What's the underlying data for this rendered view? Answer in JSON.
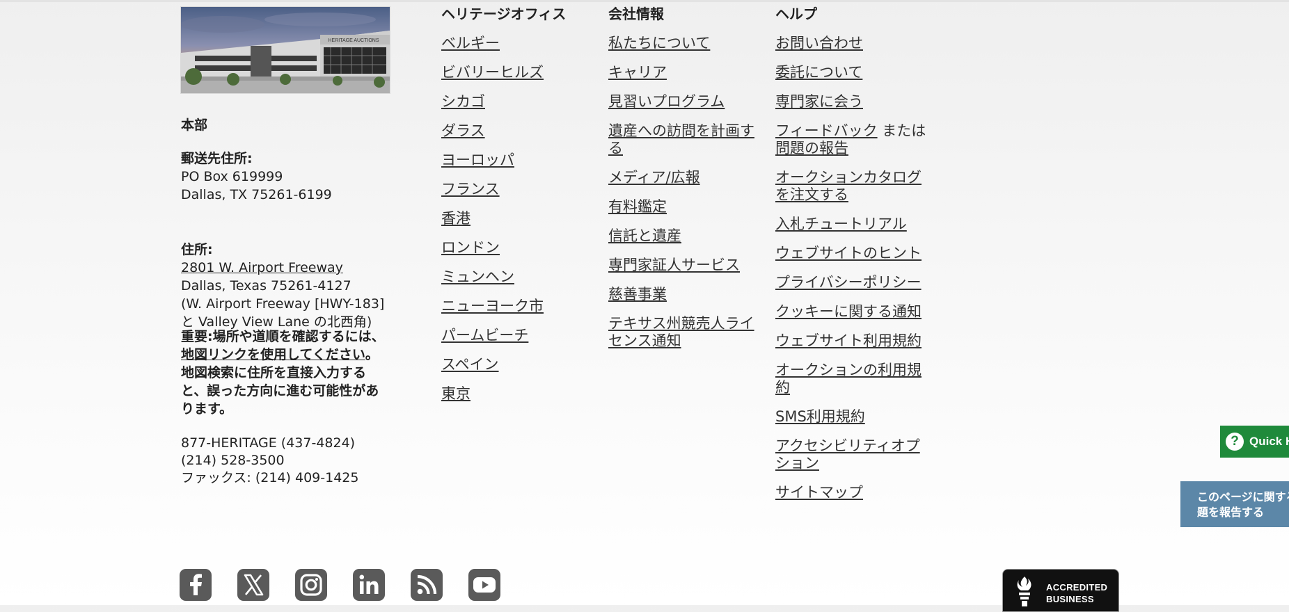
{
  "headquarters": {
    "title": "本部",
    "mailing_label": "郵送先住所:",
    "mailing_line1": "PO Box 619999",
    "mailing_line2": "Dallas, TX 75261-6199",
    "address_label": "住所:",
    "address_link": "2801 W. Airport Freeway",
    "address_line2": "Dallas, Texas 75261-4127",
    "address_line3": "(W. Airport Freeway [HWY-183]",
    "address_line4": "と Valley View Lane の北西角)",
    "warning_prefix": "重要:場所や道順を確認するには、",
    "warning_link": "地図リンクを使用してください",
    "warning_suffix": "。地図検索に住所を直接入力すると、誤った方向に進む可能性があります。",
    "phone1": "877-HERITAGE (437-4824)",
    "phone2": "(214) 528-3500",
    "fax": "ファックス: (214) 409-1425",
    "photo_sign": "HERITAGE AUCTIONS"
  },
  "offices": {
    "heading": "ヘリテージオフィス",
    "items": [
      "ベルギー",
      "ビバリーヒルズ",
      "シカゴ",
      "ダラス",
      "ヨーロッパ",
      "フランス",
      "香港",
      "ロンドン",
      "ミュンヘン",
      "ニューヨーク市",
      "パームビーチ",
      "スペイン",
      "東京"
    ]
  },
  "company": {
    "heading": "会社情報",
    "items": [
      "私たちについて",
      "キャリア",
      "見習いプログラム",
      "遺産への訪問を計画する",
      "メディア/広報",
      "有料鑑定",
      "信託と遺産",
      "専門家証人サービス",
      "慈善事業",
      "テキサス州競売人ライセンス通知"
    ]
  },
  "help": {
    "heading": "ヘルプ",
    "contact": "お問い合わせ",
    "consign": "委託について",
    "expert": "専門家に会う",
    "feedback_link": "フィードバック",
    "feedback_or": " または ",
    "report_link": "問題の報告",
    "catalog": "オークションカタログを注文する",
    "tutorial": "入札チュートリアル",
    "tips": "ウェブサイトのヒント",
    "privacy": "プライバシーポリシー",
    "cookie": "クッキーに関する通知",
    "terms": "ウェブサイト利用規約",
    "auction_terms": "オークションの利用規約",
    "sms": "SMS利用規約",
    "accessibility": "アクセシビリティオプション",
    "sitemap": "サイトマップ"
  },
  "widgets": {
    "quick_help": "Quick Help",
    "report_issue": "このページに関する問題を報告する"
  },
  "bbb": {
    "line1": "ACCREDITED",
    "line2": "BUSINESS"
  }
}
